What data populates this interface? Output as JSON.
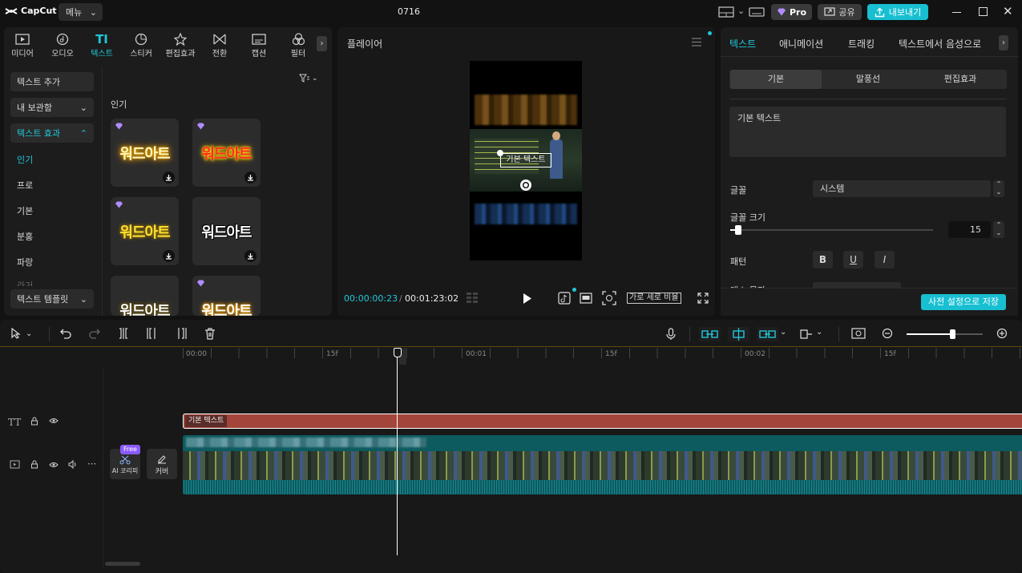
{
  "app": {
    "logo": "CapCut",
    "menu_label": "메뉴",
    "title": "0716"
  },
  "topbar": {
    "pro_label": "Pro",
    "share_label": "공유",
    "export_label": "내보내기"
  },
  "left_tabs": [
    {
      "label": "미디어",
      "icon": "media-icon"
    },
    {
      "label": "오디오",
      "icon": "audio-icon"
    },
    {
      "label": "텍스트",
      "icon": "text-icon",
      "active": true
    },
    {
      "label": "스티커",
      "icon": "sticker-icon"
    },
    {
      "label": "편집효과",
      "icon": "effects-icon"
    },
    {
      "label": "전환",
      "icon": "transition-icon"
    },
    {
      "label": "캡션",
      "icon": "caption-icon"
    },
    {
      "label": "필터",
      "icon": "filter-icon"
    }
  ],
  "left_sidebar": {
    "add_text": "텍스트 추가",
    "my_library": "내 보관함",
    "text_effects": "텍스트 효과",
    "sub_items": [
      "인기",
      "프로",
      "기본",
      "분홍",
      "파랑",
      "라거"
    ],
    "text_template": "텍스트 템플릿"
  },
  "text_gallery": {
    "section_title": "인기",
    "sample_text": "워드아트",
    "styles": [
      "gold-glow",
      "red-yellow",
      "yellow-outline",
      "white-outline",
      "white-gold",
      "gold-outline"
    ]
  },
  "player": {
    "title": "플레이어",
    "overlay_text": "기본 텍스트",
    "current_time": "00:00:00:23",
    "separator": "/",
    "total_time": "00:01:23:02",
    "ratio_label": "가로 세로 비율"
  },
  "right_tabs": [
    "텍스트",
    "애니메이션",
    "트래킹",
    "텍스트에서 음성으로"
  ],
  "right_segments": [
    "기본",
    "말풍선",
    "편집효과"
  ],
  "text_props": {
    "content": "기본 텍스트",
    "font_label": "글꼴",
    "font_value": "시스템",
    "size_label": "글꼴 크기",
    "size_value": "15",
    "size_fraction": 0.04,
    "pattern_label": "패턴",
    "pattern_buttons": [
      "B",
      "U",
      "I"
    ],
    "cut_label": "대소 문자",
    "save_preset": "사전 설정으로 저장"
  },
  "timeline": {
    "ticks": [
      "00:00",
      "15f",
      "00:01",
      "15f",
      "00:02",
      "15f"
    ],
    "text_clip_label": "기본 텍스트",
    "free_badge": "Free",
    "ai_label": "AI 코리피",
    "cover_label": "커버",
    "zoom_fraction": 0.6
  },
  "colors": {
    "accent": "#20c7d9",
    "text_clip": "#a3453a",
    "video_clip": "#0d5a5f",
    "export": "#17bfd1"
  }
}
